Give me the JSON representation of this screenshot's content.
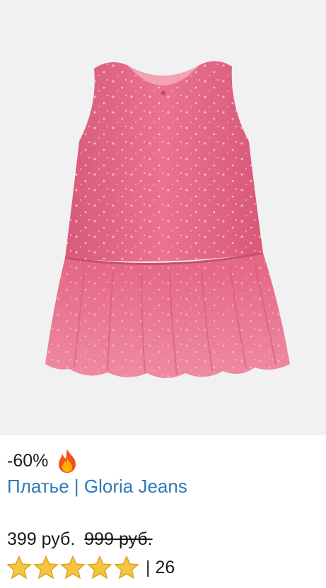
{
  "product": {
    "discount": "-60%",
    "fire_icon": "fire-emoji-icon",
    "title": "Платье | Gloria Jeans",
    "price": "399 руб.",
    "old_price": "999 руб.",
    "rating": {
      "stars": 5,
      "max": 5,
      "separator_and_count": "| 26"
    },
    "image_icon": "pink-tulle-dress-photo",
    "colors": {
      "link": "#2f7ab8",
      "dress": "#e66a88",
      "star": "#f5c542",
      "image_bg": "#f1f1f1"
    }
  }
}
